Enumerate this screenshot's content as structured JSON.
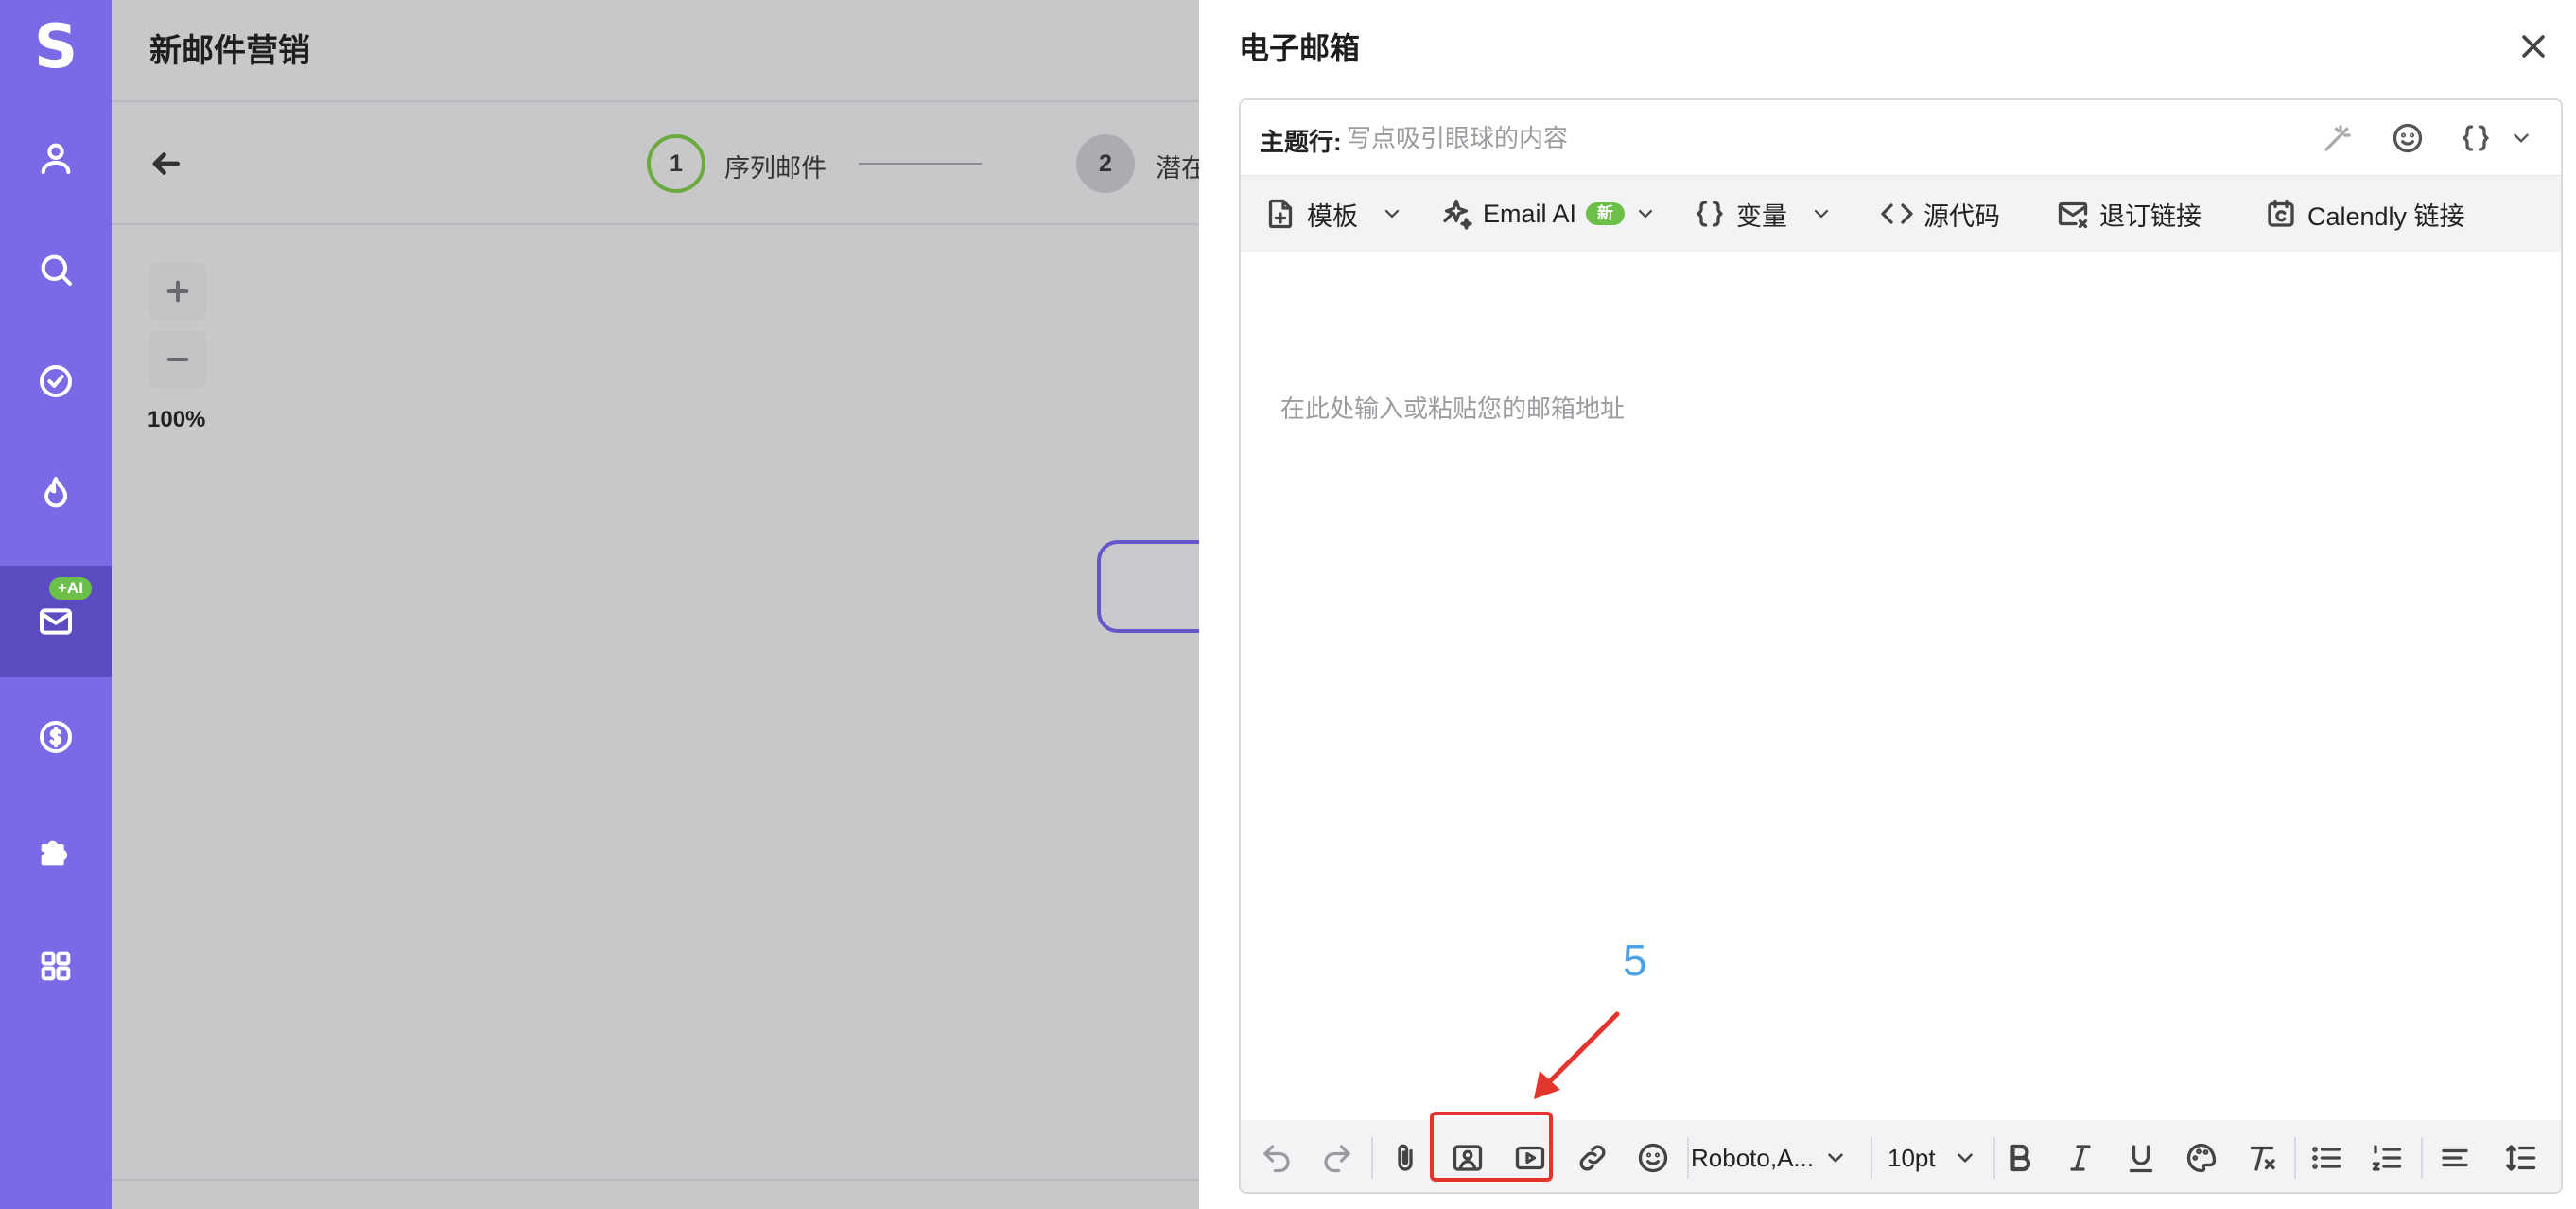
{
  "sidebar": {
    "logo": "S",
    "ai_badge": "+AI",
    "items": [
      {
        "icon": "user-icon"
      },
      {
        "icon": "search-icon"
      },
      {
        "icon": "check-circle-icon"
      },
      {
        "icon": "flame-icon"
      },
      {
        "icon": "mail-icon",
        "active": true
      },
      {
        "icon": "dollar-icon"
      },
      {
        "icon": "puzzle-icon"
      },
      {
        "icon": "apps-grid-icon"
      }
    ]
  },
  "page": {
    "title": "新邮件营销",
    "steps": [
      {
        "number": "1",
        "label": "序列邮件"
      },
      {
        "number": "2",
        "label": "潜在"
      }
    ],
    "zoom_level": "100%"
  },
  "drawer": {
    "title": "电子邮箱",
    "subject": {
      "label": "主题行:",
      "placeholder": "写点吸引眼球的内容",
      "value": ""
    },
    "toolbar_top": {
      "template": "模板",
      "email_ai": "Email AI",
      "new_badge": "新",
      "variables": "变量",
      "source_code": "源代码",
      "unsubscribe_link": "退订链接",
      "calendly_link": "Calendly 链接"
    },
    "body_placeholder": "在此处输入或粘贴您的邮箱地址",
    "toolbar_bottom": {
      "font_family": "Roboto,A...",
      "font_size": "10pt"
    }
  },
  "annotation": {
    "number": "5",
    "color": "#e3352b",
    "number_color": "#4aa3e8"
  },
  "colors": {
    "sidebar": "#7b6ae6",
    "sidebar_active": "#5c4cc2",
    "badge_green": "#6cc04a",
    "step_active": "#6aaa3e"
  }
}
